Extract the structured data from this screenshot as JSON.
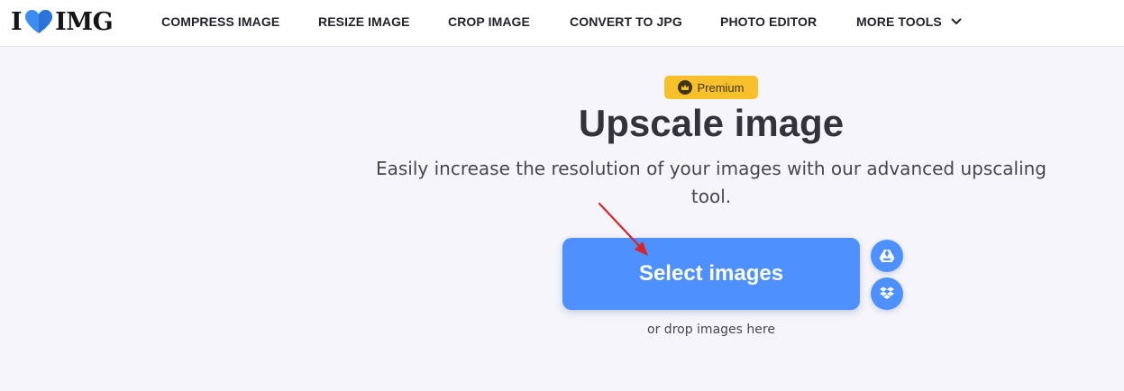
{
  "logo": {
    "text_left": "I",
    "text_right": "IMG"
  },
  "nav": {
    "items": [
      {
        "label": "COMPRESS IMAGE"
      },
      {
        "label": "RESIZE IMAGE"
      },
      {
        "label": "CROP IMAGE"
      },
      {
        "label": "CONVERT TO JPG"
      },
      {
        "label": "PHOTO EDITOR"
      },
      {
        "label": "MORE TOOLS"
      }
    ]
  },
  "hero": {
    "badge": "Premium",
    "title": "Upscale image",
    "subtitle": "Easily increase the resolution of your images with our advanced upscaling tool.",
    "select_button": "Select images",
    "drop_text": "or drop images here"
  },
  "icons": {
    "crown": "crown-icon",
    "google_drive": "google-drive-icon",
    "dropbox": "dropbox-icon",
    "chevron": "chevron-down-icon",
    "heart": "heart-icon"
  },
  "colors": {
    "accent": "#4d90fe",
    "badge": "#f8c12c",
    "background": "#f5f5fa",
    "annotation_arrow": "#d8232a"
  }
}
